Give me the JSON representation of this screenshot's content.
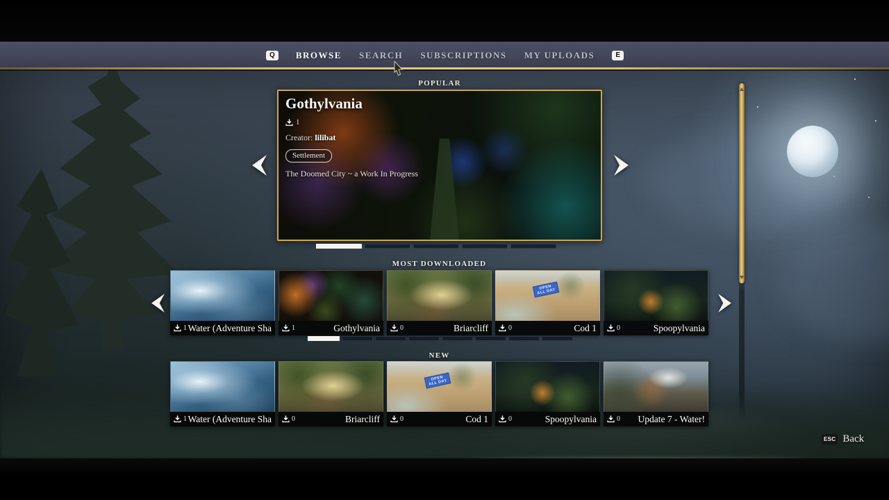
{
  "colors": {
    "accent_gold": "#d2b269",
    "nav_bg": "#434759",
    "active_tab": "#ffffff",
    "inactive_tab": "#b9bcca"
  },
  "nav": {
    "prev_key": "Q",
    "next_key": "E",
    "tabs": [
      {
        "label": "BROWSE",
        "active": true
      },
      {
        "label": "SEARCH",
        "active": false
      },
      {
        "label": "SUBSCRIPTIONS",
        "active": false
      },
      {
        "label": "MY UPLOADS",
        "active": false
      }
    ]
  },
  "featured": {
    "section_label": "POPULAR",
    "title": "Gothylvania",
    "downloads": "1",
    "creator_label": "Creator:",
    "creator_name": "lilibat",
    "tag": "Settlement",
    "description": "The Doomed City ~ a Work In Progress",
    "page_count": 5,
    "active_page": 1
  },
  "rows": [
    {
      "section_label": "MOST DOWNLOADED",
      "page_count": 8,
      "active_page": 1,
      "tiles": [
        {
          "downloads": "1",
          "title": "Water (Adventure Sha",
          "thumb": "water-lake"
        },
        {
          "downloads": "1",
          "title": "Gothylvania",
          "thumb": "gothic-night-town"
        },
        {
          "downloads": "0",
          "title": "Briarcliff",
          "thumb": "sunny-forest-village"
        },
        {
          "downloads": "0",
          "title": "Cod 1",
          "thumb": "sandy-shore-sign"
        },
        {
          "downloads": "0",
          "title": "Spoopylvania",
          "thumb": "dark-gate-campfire"
        }
      ]
    },
    {
      "section_label": "NEW",
      "tiles": [
        {
          "downloads": "1",
          "title": "Water (Adventure Sha",
          "thumb": "water-lake"
        },
        {
          "downloads": "0",
          "title": "Briarcliff",
          "thumb": "sunny-forest-village"
        },
        {
          "downloads": "0",
          "title": "Cod 1",
          "thumb": "sandy-shore-sign"
        },
        {
          "downloads": "0",
          "title": "Spoopylvania",
          "thumb": "dark-gate-campfire"
        },
        {
          "downloads": "0",
          "title": "Update 7 - Water!",
          "thumb": "daytime-tower-build"
        }
      ]
    }
  ],
  "cod_sign": {
    "line1": "OPEN",
    "line2": "ALL DAY"
  },
  "footer": {
    "key": "ESC",
    "label": "Back"
  }
}
